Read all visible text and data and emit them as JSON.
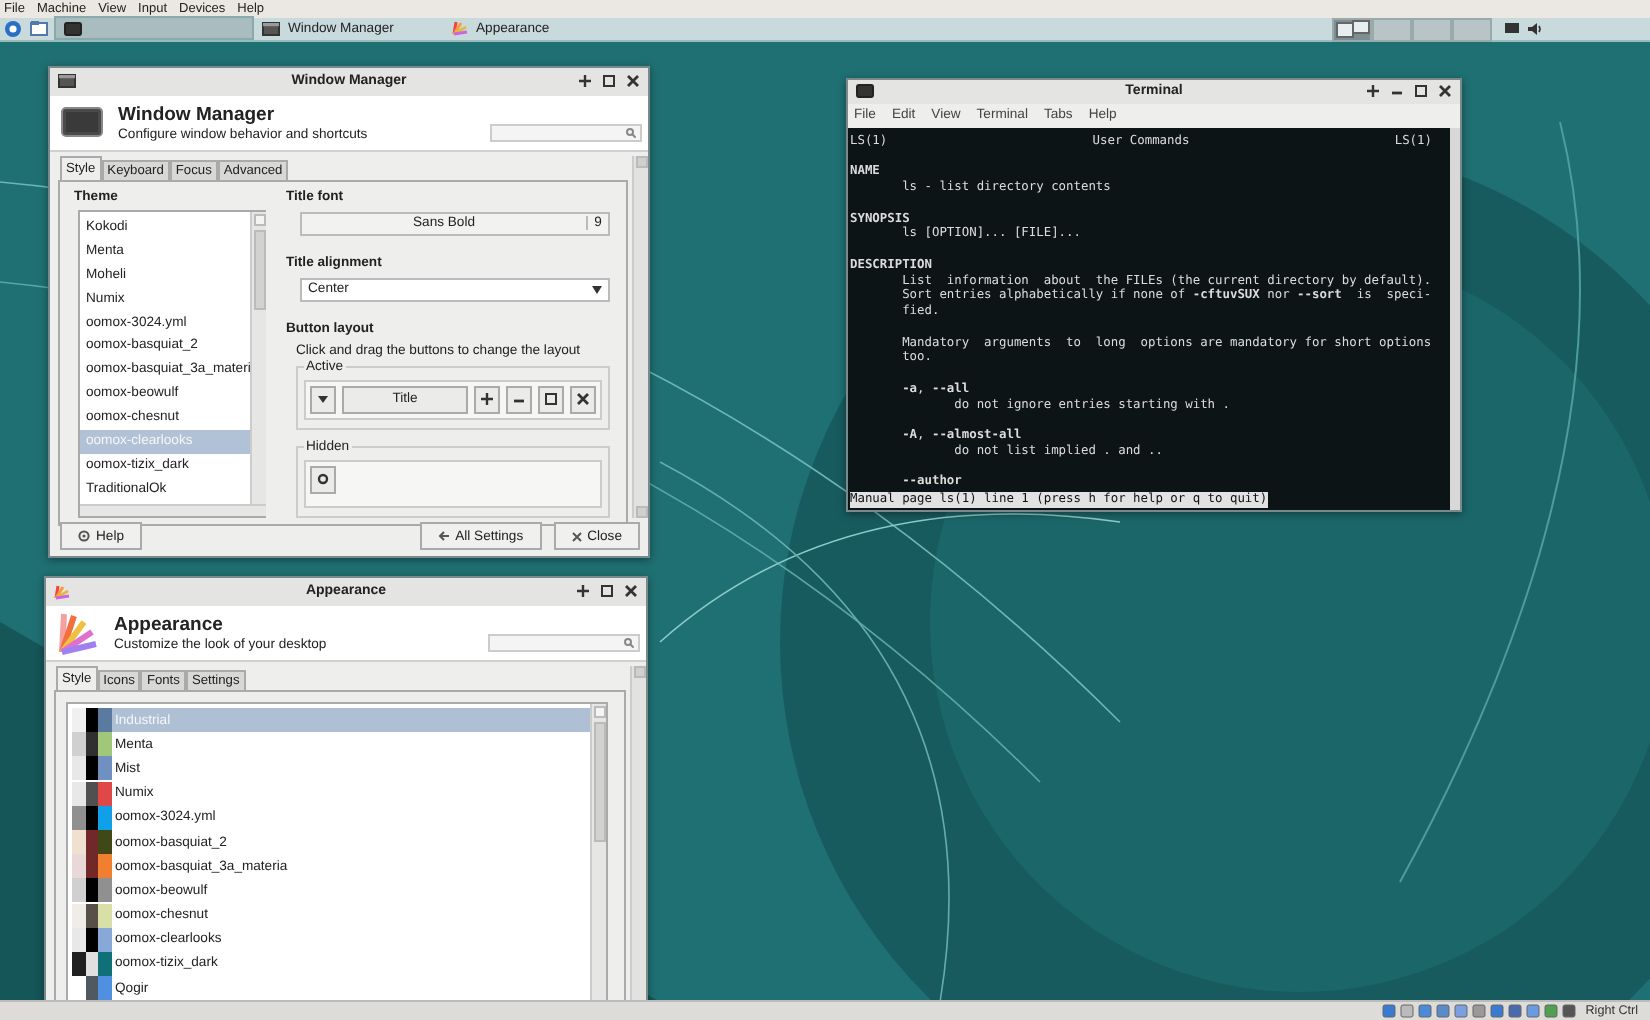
{
  "host_menu": [
    "File",
    "Machine",
    "View",
    "Input",
    "Devices",
    "Help"
  ],
  "panel": {
    "tasks": [
      {
        "kind": "terminal",
        "selected": true
      },
      {
        "kind": "window-manager",
        "label": "Window Manager",
        "selected": false
      },
      {
        "kind": "appearance",
        "label": "Appearance",
        "selected": false
      }
    ],
    "workspaces": [
      {
        "selected": true
      },
      {
        "selected": false
      },
      {
        "selected": false
      },
      {
        "selected": false
      }
    ]
  },
  "window_manager": {
    "title": "Window Manager",
    "title_buttons": [
      {
        "kind": "stick"
      },
      {
        "kind": "maximize"
      },
      {
        "kind": "close"
      }
    ],
    "heading": "Window Manager",
    "subtitle": "Configure window behavior and shortcuts",
    "tabs": [
      {
        "label": "Style",
        "selected": true
      },
      {
        "label": "Keyboard",
        "selected": false
      },
      {
        "label": "Focus",
        "selected": false
      },
      {
        "label": "Advanced",
        "selected": false
      }
    ],
    "theme_label": "Theme",
    "themes": [
      {
        "name": "Kokodi",
        "selected": false
      },
      {
        "name": "Menta",
        "selected": false
      },
      {
        "name": "Moheli",
        "selected": false
      },
      {
        "name": "Numix",
        "selected": false
      },
      {
        "name": "oomox-3024.yml",
        "selected": false
      },
      {
        "name": "oomox-basquiat_2",
        "selected": false
      },
      {
        "name": "oomox-basquiat_3a_materi",
        "selected": false
      },
      {
        "name": "oomox-beowulf",
        "selected": false
      },
      {
        "name": "oomox-chesnut",
        "selected": false
      },
      {
        "name": "oomox-clearlooks",
        "selected": true
      },
      {
        "name": "oomox-tizix_dark",
        "selected": false
      },
      {
        "name": "TraditionalOk",
        "selected": false
      }
    ],
    "title_font_label": "Title font",
    "title_font": "Sans Bold",
    "title_font_size": "9",
    "title_alignment_label": "Title alignment",
    "title_alignment": "Center",
    "button_layout_label": "Button layout",
    "button_layout_hint": "Click and drag the buttons to change the layout",
    "active_label": "Active",
    "active_buttons": [
      {
        "kind": "menu"
      },
      {
        "kind": "title",
        "label": "Title"
      },
      {
        "kind": "stick"
      },
      {
        "kind": "minimize"
      },
      {
        "kind": "maximize"
      },
      {
        "kind": "close"
      }
    ],
    "hidden_label": "Hidden",
    "hidden_buttons": [
      {
        "kind": "shade"
      }
    ],
    "footer_buttons": [
      {
        "kind": "help",
        "label": "Help"
      },
      {
        "kind": "all-settings",
        "label": "All Settings"
      },
      {
        "kind": "close",
        "label": "Close"
      }
    ]
  },
  "terminal": {
    "title": "Terminal",
    "title_buttons": [
      {
        "kind": "stick"
      },
      {
        "kind": "minimize"
      },
      {
        "kind": "maximize"
      },
      {
        "kind": "close"
      }
    ],
    "menu": [
      "File",
      "Edit",
      "View",
      "Terminal",
      "Tabs",
      "Help"
    ],
    "header": [
      "LS(1)",
      "User Commands",
      "LS(1)"
    ],
    "blocks": [
      [
        {
          "text": "NAME",
          "bold": true
        },
        {
          "text": "       ls - list directory contents"
        }
      ],
      [
        {
          "text": "SYNOPSIS",
          "bold": true
        },
        {
          "text": "       ls [OPTION]... [FILE]..."
        }
      ],
      [
        {
          "text": "DESCRIPTION",
          "bold": true
        },
        {
          "text": "       List  information  about  the FILEs (the current directory by default)."
        },
        {
          "text": "       Sort entries alphabetically if none of **-cftuvSUX** nor **--sort**  is  speci-"
        },
        {
          "text": "       fied."
        }
      ],
      [
        {
          "text": "       Mandatory  arguments  to  long  options are mandatory for short options"
        },
        {
          "text": "       too."
        }
      ],
      [
        {
          "text": "       **-a**, **--all**"
        },
        {
          "text": "              do not ignore entries starting with ."
        }
      ],
      [
        {
          "text": "       **-A**, **--almost-all**"
        },
        {
          "text": "              do not list implied . and .."
        }
      ],
      [
        {
          "text": "       --author",
          "bold": true
        }
      ]
    ],
    "status": "Manual page ls(1) line 1 (press h for help or q to quit)"
  },
  "appearance": {
    "title": "Appearance",
    "title_buttons": [
      {
        "kind": "stick"
      },
      {
        "kind": "maximize"
      },
      {
        "kind": "close"
      }
    ],
    "heading": "Appearance",
    "subtitle": "Customize the look of your desktop",
    "tabs": [
      {
        "label": "Style",
        "selected": true
      },
      {
        "label": "Icons",
        "selected": false
      },
      {
        "label": "Fonts",
        "selected": false
      },
      {
        "label": "Settings",
        "selected": false
      }
    ],
    "styles": [
      {
        "name": "Industrial",
        "selected": true,
        "swatches": [
          {
            "color": "#f0f0f0"
          },
          {
            "color": "#000000"
          },
          {
            "color": "#5a7aa0"
          }
        ]
      },
      {
        "name": "Menta",
        "selected": false,
        "swatches": [
          {
            "color": "#d0d0d0"
          },
          {
            "color": "#303030"
          },
          {
            "color": "#a0c878"
          }
        ]
      },
      {
        "name": "Mist",
        "selected": false,
        "swatches": [
          {
            "color": "#e8e8e8"
          },
          {
            "color": "#000000"
          },
          {
            "color": "#7090c0"
          }
        ]
      },
      {
        "name": "Numix",
        "selected": false,
        "swatches": [
          {
            "color": "#e8e8e8"
          },
          {
            "color": "#505050"
          },
          {
            "color": "#e04848"
          }
        ]
      },
      {
        "name": "oomox-3024.yml",
        "selected": false,
        "swatches": [
          {
            "color": "#909090"
          },
          {
            "color": "#000000"
          },
          {
            "color": "#10a0e8"
          }
        ]
      },
      {
        "name": "oomox-basquiat_2",
        "selected": false,
        "swatches": [
          {
            "color": "#f0e0d0"
          },
          {
            "color": "#702828"
          },
          {
            "color": "#404818"
          }
        ]
      },
      {
        "name": "oomox-basquiat_3a_materia",
        "selected": false,
        "swatches": [
          {
            "color": "#e8d8d8"
          },
          {
            "color": "#702828"
          },
          {
            "color": "#f08030"
          }
        ]
      },
      {
        "name": "oomox-beowulf",
        "selected": false,
        "swatches": [
          {
            "color": "#d0d0d0"
          },
          {
            "color": "#000000"
          },
          {
            "color": "#909090"
          }
        ]
      },
      {
        "name": "oomox-chesnut",
        "selected": false,
        "swatches": [
          {
            "color": "#f0ece8"
          },
          {
            "color": "#585048"
          },
          {
            "color": "#d8e0a8"
          }
        ]
      },
      {
        "name": "oomox-clearlooks",
        "selected": false,
        "swatches": [
          {
            "color": "#e8e8e8"
          },
          {
            "color": "#000000"
          },
          {
            "color": "#88a8d8"
          }
        ]
      },
      {
        "name": "oomox-tizix_dark",
        "selected": false,
        "swatches": [
          {
            "color": "#202020"
          },
          {
            "color": "#e0e0e0"
          },
          {
            "color": "#107078"
          }
        ]
      },
      {
        "name": "Qogir",
        "selected": false,
        "swatches": [
          {
            "color": "#505860"
          },
          {
            "color": "#5090e0"
          }
        ]
      }
    ]
  },
  "status_bar": {
    "label": "Right Ctrl"
  }
}
